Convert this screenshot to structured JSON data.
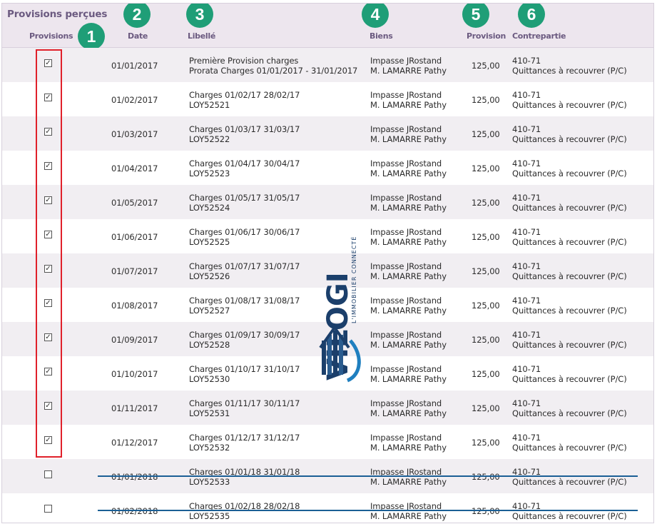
{
  "section_title": "Provisions perçues",
  "columns": {
    "provisions": "Provisions",
    "date": "Date",
    "libelle": "Libellé",
    "biens": "Biens",
    "provision": "Provision",
    "contrepartie": "Contrepartie"
  },
  "badges": [
    "1",
    "2",
    "3",
    "4",
    "5",
    "6"
  ],
  "watermark": {
    "brand": "VILOGI",
    "tagline": "L'IMMOBILIER CONNECTÉ"
  },
  "colors": {
    "badge": "#1f9e77",
    "highlight": "#e0202a",
    "strike": "#1b5f95",
    "header_text": "#6b5a80"
  },
  "rows": [
    {
      "checked": true,
      "date": "01/01/2017",
      "lib1": "Première Provision charges",
      "lib2": "Prorata Charges 01/01/2017 - 31/01/2017",
      "bien1": "Impasse JRostand",
      "bien2": "M. LAMARRE Pathy",
      "provision": "125,00",
      "contre1": "410-71",
      "contre2": "Quittances à recouvrer (P/C)",
      "struck": false
    },
    {
      "checked": true,
      "date": "01/02/2017",
      "lib1": "Charges 01/02/17 28/02/17",
      "lib2": "LOY52521",
      "bien1": "Impasse JRostand",
      "bien2": "M. LAMARRE Pathy",
      "provision": "125,00",
      "contre1": "410-71",
      "contre2": "Quittances à recouvrer (P/C)",
      "struck": false
    },
    {
      "checked": true,
      "date": "01/03/2017",
      "lib1": "Charges 01/03/17 31/03/17",
      "lib2": "LOY52522",
      "bien1": "Impasse JRostand",
      "bien2": "M. LAMARRE Pathy",
      "provision": "125,00",
      "contre1": "410-71",
      "contre2": "Quittances à recouvrer (P/C)",
      "struck": false
    },
    {
      "checked": true,
      "date": "01/04/2017",
      "lib1": "Charges 01/04/17 30/04/17",
      "lib2": "LOY52523",
      "bien1": "Impasse JRostand",
      "bien2": "M. LAMARRE Pathy",
      "provision": "125,00",
      "contre1": "410-71",
      "contre2": "Quittances à recouvrer (P/C)",
      "struck": false
    },
    {
      "checked": true,
      "date": "01/05/2017",
      "lib1": "Charges 01/05/17 31/05/17",
      "lib2": "LOY52524",
      "bien1": "Impasse JRostand",
      "bien2": "M. LAMARRE Pathy",
      "provision": "125,00",
      "contre1": "410-71",
      "contre2": "Quittances à recouvrer (P/C)",
      "struck": false
    },
    {
      "checked": true,
      "date": "01/06/2017",
      "lib1": "Charges 01/06/17 30/06/17",
      "lib2": "LOY52525",
      "bien1": "Impasse JRostand",
      "bien2": "M. LAMARRE Pathy",
      "provision": "125,00",
      "contre1": "410-71",
      "contre2": "Quittances à recouvrer (P/C)",
      "struck": false
    },
    {
      "checked": true,
      "date": "01/07/2017",
      "lib1": "Charges 01/07/17 31/07/17",
      "lib2": "LOY52526",
      "bien1": "Impasse JRostand",
      "bien2": "M. LAMARRE Pathy",
      "provision": "125,00",
      "contre1": "410-71",
      "contre2": "Quittances à recouvrer (P/C)",
      "struck": false
    },
    {
      "checked": true,
      "date": "01/08/2017",
      "lib1": "Charges 01/08/17 31/08/17",
      "lib2": "LOY52527",
      "bien1": "Impasse JRostand",
      "bien2": "M. LAMARRE Pathy",
      "provision": "125,00",
      "contre1": "410-71",
      "contre2": "Quittances à recouvrer (P/C)",
      "struck": false
    },
    {
      "checked": true,
      "date": "01/09/2017",
      "lib1": "Charges 01/09/17 30/09/17",
      "lib2": "LOY52528",
      "bien1": "Impasse JRostand",
      "bien2": "M. LAMARRE Pathy",
      "provision": "125,00",
      "contre1": "410-71",
      "contre2": "Quittances à recouvrer (P/C)",
      "struck": false
    },
    {
      "checked": true,
      "date": "01/10/2017",
      "lib1": "Charges 01/10/17 31/10/17",
      "lib2": "LOY52530",
      "bien1": "Impasse JRostand",
      "bien2": "M. LAMARRE Pathy",
      "provision": "125,00",
      "contre1": "410-71",
      "contre2": "Quittances à recouvrer (P/C)",
      "struck": false
    },
    {
      "checked": true,
      "date": "01/11/2017",
      "lib1": "Charges 01/11/17 30/11/17",
      "lib2": "LOY52531",
      "bien1": "Impasse JRostand",
      "bien2": "M. LAMARRE Pathy",
      "provision": "125,00",
      "contre1": "410-71",
      "contre2": "Quittances à recouvrer (P/C)",
      "struck": false
    },
    {
      "checked": true,
      "date": "01/12/2017",
      "lib1": "Charges 01/12/17 31/12/17",
      "lib2": "LOY52532",
      "bien1": "Impasse JRostand",
      "bien2": "M. LAMARRE Pathy",
      "provision": "125,00",
      "contre1": "410-71",
      "contre2": "Quittances à recouvrer (P/C)",
      "struck": false
    },
    {
      "checked": false,
      "date": "01/01/2018",
      "lib1": "Charges 01/01/18 31/01/18",
      "lib2": "LOY52533",
      "bien1": "Impasse JRostand",
      "bien2": "M. LAMARRE Pathy",
      "provision": "125,00",
      "contre1": "410-71",
      "contre2": "Quittances à recouvrer (P/C)",
      "struck": true
    },
    {
      "checked": false,
      "date": "01/02/2018",
      "lib1": "Charges 01/02/18 28/02/18",
      "lib2": "LOY52535",
      "bien1": "Impasse JRostand",
      "bien2": "M. LAMARRE Pathy",
      "provision": "125,00",
      "contre1": "410-71",
      "contre2": "Quittances à recouvrer (P/C)",
      "struck": true
    }
  ]
}
